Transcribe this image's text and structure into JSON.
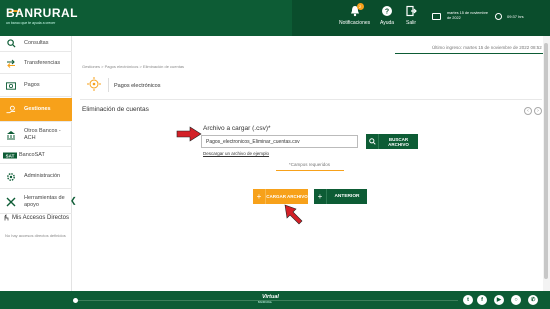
{
  "header": {
    "logo_text": "BANRURAL",
    "logo_tagline": "un banco que te ayuda a crecer",
    "notifications_label": "Notificaciones",
    "notifications_count": "2",
    "help_label": "Ayuda",
    "exit_label": "Salir",
    "date_text": "martes 15 de noviembre de 2022",
    "time_text": "09:37 hrs"
  },
  "sidebar": {
    "items": [
      {
        "label": "Consultas",
        "icon": "search-icon"
      },
      {
        "label": "Transferencias",
        "icon": "transfer-icon"
      },
      {
        "label": "Pagos",
        "icon": "cash-icon"
      },
      {
        "label": "Gestiones",
        "icon": "hand-coin-icon"
      },
      {
        "label": "Otros Bancos - ACH",
        "icon": "bank-icon"
      },
      {
        "label": "BancoSAT",
        "icon": "bancosat-logo-icon"
      },
      {
        "label": "Administración",
        "icon": "admin-gear-icon"
      },
      {
        "label": "Herramientas de apoyo",
        "icon": "tools-icon"
      }
    ],
    "shortcuts_title": "Mis Accesos Directos",
    "shortcuts_empty": "No hay accesos directos definidos"
  },
  "main": {
    "last_login": "Último ingreso: martes 15 de noviembre de 2022 08:52",
    "breadcrumb": "Gestiones > Pagos electrónicos > Eliminación de cuentas",
    "section_title": "Pagos electrónicos",
    "page_title": "Eliminación de cuentas",
    "file_label": "Archivo a cargar (.csv)*",
    "file_value": "Pagos_electronicos_Eliminar_cuentas.csv",
    "search_button": "BUSCAR ARCHIVO",
    "download_link": "Descargar un archivo de ejemplo",
    "required_note": "*Campos requeridos",
    "upload_button": "CARGAR ARCHIVO",
    "back_button": "ANTERIOR"
  },
  "footer": {
    "brand": "Virtual",
    "brand_sub": "BANRURAL",
    "social": [
      "twitter-icon",
      "facebook-icon",
      "youtube-icon",
      "instagram-icon",
      "whatsapp-icon"
    ]
  },
  "colors": {
    "primary_green": "#0d5c35",
    "accent_orange": "#f7a11a",
    "arrow_red": "#d32027"
  }
}
